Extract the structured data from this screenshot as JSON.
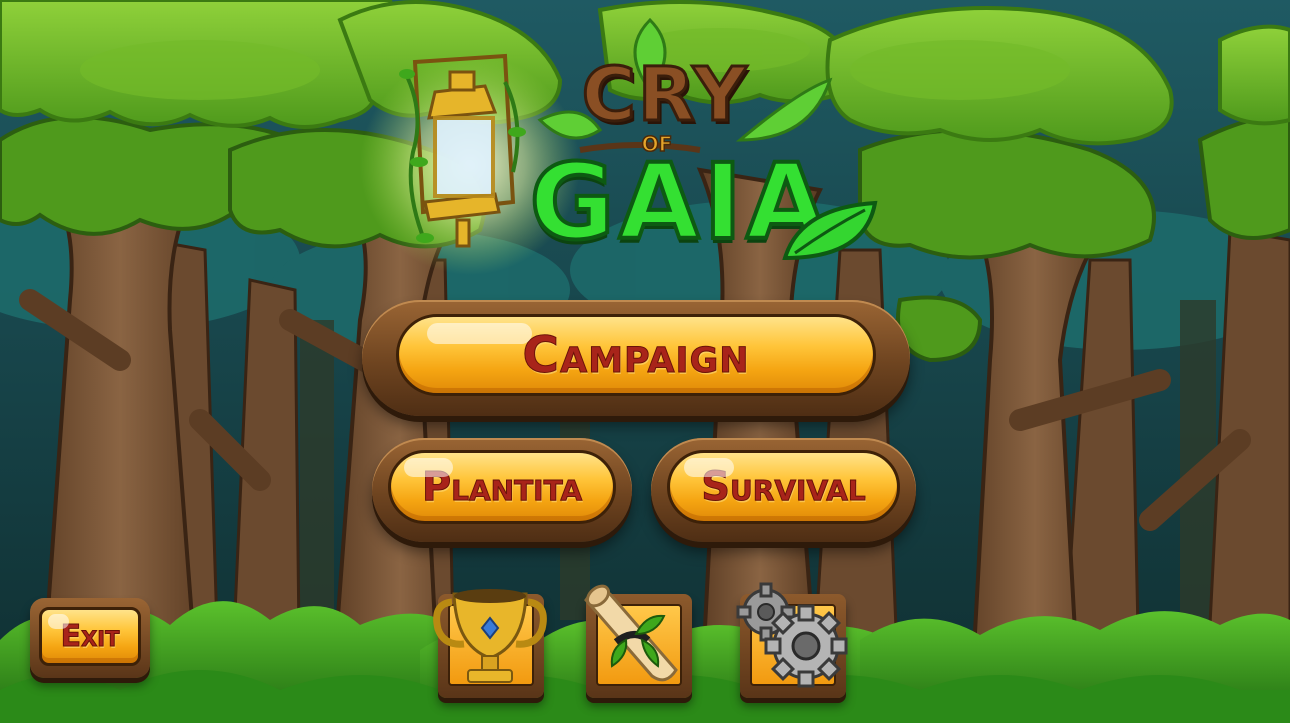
{
  "game": {
    "title_line1": "CRY",
    "title_of": "OF",
    "title_line2": "GAIA"
  },
  "menu": {
    "campaign_label": "Campaign",
    "plantita_label": "Plantita",
    "survival_label": "Survival",
    "exit_label": "Exit"
  },
  "icons": {
    "lantern": "lantern-icon",
    "trophy": "trophy-icon",
    "scroll": "scroll-icon",
    "settings": "gear-icon"
  },
  "colors": {
    "button_gold": "#ffc53a",
    "button_text": "#a8241a",
    "wood": "#6e4420",
    "logo_green": "#34e032",
    "logo_brown": "#8a4f24"
  }
}
